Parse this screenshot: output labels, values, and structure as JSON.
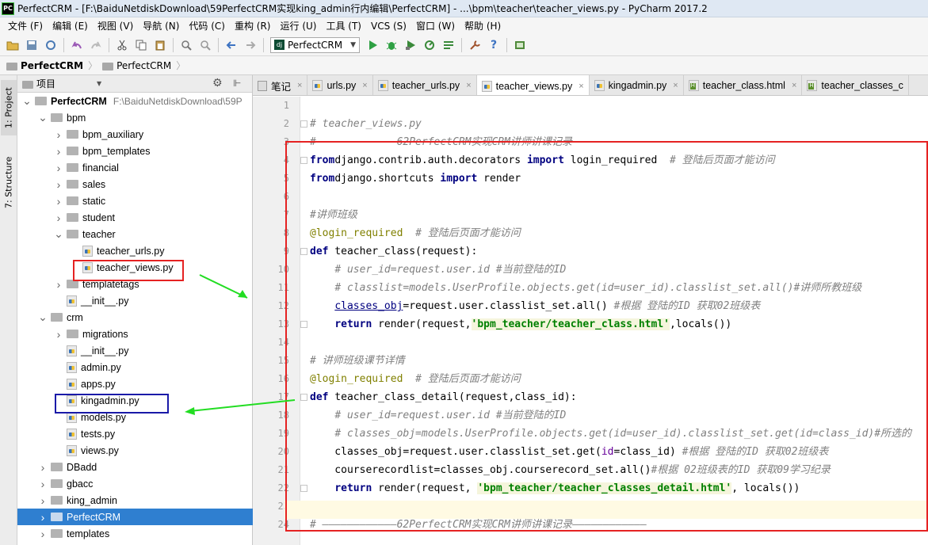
{
  "window": {
    "title": "PerfectCRM - [F:\\BaiduNetdiskDownload\\59PerfectCRM实现king_admin行内编辑\\PerfectCRM] - ...\\bpm\\teacher\\teacher_views.py - PyCharm 2017.2",
    "logo": "PC"
  },
  "menu": [
    "文件 (F)",
    "编辑 (E)",
    "视图 (V)",
    "导航 (N)",
    "代码 (C)",
    "重构 (R)",
    "运行 (U)",
    "工具 (T)",
    "VCS (S)",
    "窗口 (W)",
    "帮助 (H)"
  ],
  "toolbar": {
    "run_config": "PerfectCRM",
    "dj": "dj"
  },
  "breadcrumb": [
    "PerfectCRM",
    "PerfectCRM"
  ],
  "left_tool_tabs": [
    "1: Project",
    "7: Structure"
  ],
  "project_panel": {
    "title": "项目"
  },
  "tree": [
    {
      "label": "PerfectCRM",
      "path": "F:\\BaiduNetdiskDownload\\59P",
      "type": "folder",
      "depth": 0,
      "expanded": true,
      "bold": true
    },
    {
      "label": "bpm",
      "type": "folder",
      "depth": 1,
      "expanded": true
    },
    {
      "label": "bpm_auxiliary",
      "type": "folder",
      "depth": 2,
      "expanded": false
    },
    {
      "label": "bpm_templates",
      "type": "folder",
      "depth": 2,
      "expanded": false
    },
    {
      "label": "financial",
      "type": "folder",
      "depth": 2,
      "expanded": false
    },
    {
      "label": "sales",
      "type": "folder",
      "depth": 2,
      "expanded": false
    },
    {
      "label": "static",
      "type": "folder",
      "depth": 2,
      "expanded": false
    },
    {
      "label": "student",
      "type": "folder",
      "depth": 2,
      "expanded": false
    },
    {
      "label": "teacher",
      "type": "folder",
      "depth": 2,
      "expanded": true
    },
    {
      "label": "teacher_urls.py",
      "type": "py",
      "depth": 3
    },
    {
      "label": "teacher_views.py",
      "type": "py",
      "depth": 3
    },
    {
      "label": "templatetags",
      "type": "folder",
      "depth": 2,
      "expanded": false
    },
    {
      "label": "__init__.py",
      "type": "py",
      "depth": 2
    },
    {
      "label": "crm",
      "type": "folder",
      "depth": 1,
      "expanded": true
    },
    {
      "label": "migrations",
      "type": "folder",
      "depth": 2,
      "expanded": false
    },
    {
      "label": "__init__.py",
      "type": "py",
      "depth": 2
    },
    {
      "label": "admin.py",
      "type": "py",
      "depth": 2
    },
    {
      "label": "apps.py",
      "type": "py",
      "depth": 2
    },
    {
      "label": "kingadmin.py",
      "type": "py",
      "depth": 2
    },
    {
      "label": "models.py",
      "type": "py",
      "depth": 2
    },
    {
      "label": "tests.py",
      "type": "py",
      "depth": 2
    },
    {
      "label": "views.py",
      "type": "py",
      "depth": 2
    },
    {
      "label": "DBadd",
      "type": "folder",
      "depth": 1,
      "expanded": false
    },
    {
      "label": "gbacc",
      "type": "folder",
      "depth": 1,
      "expanded": false
    },
    {
      "label": "king_admin",
      "type": "folder",
      "depth": 1,
      "expanded": false
    },
    {
      "label": "PerfectCRM",
      "type": "folder",
      "depth": 1,
      "expanded": false,
      "selected": true
    },
    {
      "label": "templates",
      "type": "folder",
      "depth": 1,
      "expanded": false
    }
  ],
  "tabs": [
    {
      "label": "笔记",
      "icon": "note",
      "active": false
    },
    {
      "label": "urls.py",
      "icon": "py",
      "active": false
    },
    {
      "label": "teacher_urls.py",
      "icon": "py",
      "active": false
    },
    {
      "label": "teacher_views.py",
      "icon": "py",
      "active": true
    },
    {
      "label": "kingadmin.py",
      "icon": "py",
      "active": false
    },
    {
      "label": "teacher_class.html",
      "icon": "html",
      "active": false
    },
    {
      "label": "teacher_classes_c",
      "icon": "html",
      "active": false
    }
  ],
  "line_numbers": [
    "1",
    "2",
    "3",
    "4",
    "5",
    "6",
    "7",
    "8",
    "9",
    "10",
    "11",
    "12",
    "13",
    "14",
    "15",
    "16",
    "17",
    "18",
    "19",
    "20",
    "21",
    "22",
    "23",
    "24"
  ],
  "code": [
    [],
    [
      [
        "cm",
        "# teacher_views.py"
      ]
    ],
    [
      [
        "cm",
        "# ————————————62PerfectCRM实现CRM讲师讲课记录————————————"
      ]
    ],
    [
      [
        "kw",
        "from"
      ],
      [
        "",
        "django.contrib.auth.decorators "
      ],
      [
        "kw",
        "import"
      ],
      [
        "",
        " login_required  "
      ],
      [
        "cm",
        "# 登陆后页面才能访问"
      ]
    ],
    [
      [
        "kw",
        "from"
      ],
      [
        "",
        "django.shortcuts "
      ],
      [
        "kw",
        "import"
      ],
      [
        "",
        " render"
      ]
    ],
    [],
    [
      [
        "cm",
        "#讲师班级"
      ]
    ],
    [
      [
        "dec",
        "@login_required"
      ],
      [
        "",
        "  "
      ],
      [
        "cm",
        "# 登陆后页面才能访问"
      ]
    ],
    [
      [
        "kw",
        "def"
      ],
      [
        "",
        " teacher_class(request):"
      ]
    ],
    [
      [
        "",
        "    "
      ],
      [
        "cm",
        "# user_id=request.user.id #当前登陆的ID"
      ]
    ],
    [
      [
        "",
        "    "
      ],
      [
        "cm",
        "# classlist=models.UserProfile.objects.get(id=user_id).classlist_set.all()#讲师所教班级"
      ]
    ],
    [
      [
        "",
        "    "
      ],
      [
        "und",
        "classes_obj"
      ],
      [
        "",
        "=request.user.classlist_set.all() "
      ],
      [
        "cm",
        "#根据 登陆的ID 获取02班级表"
      ]
    ],
    [
      [
        "",
        "    "
      ],
      [
        "kw",
        "return"
      ],
      [
        "",
        " render(request,"
      ],
      [
        "str",
        "'bpm_teacher/teacher_class.html'"
      ],
      [
        "",
        ",locals())"
      ]
    ],
    [],
    [
      [
        "cm",
        "# 讲师班级课节详情"
      ]
    ],
    [
      [
        "dec",
        "@login_required"
      ],
      [
        "",
        "  "
      ],
      [
        "cm",
        "# 登陆后页面才能访问"
      ]
    ],
    [
      [
        "kw",
        "def"
      ],
      [
        "",
        " teacher_class_detail(request,class_id):"
      ]
    ],
    [
      [
        "",
        "    "
      ],
      [
        "cm",
        "# user_id=request.user.id #当前登陆的ID"
      ]
    ],
    [
      [
        "",
        "    "
      ],
      [
        "cm",
        "# classes_obj=models.UserProfile.objects.get(id=user_id).classlist_set.get(id=class_id)#所选的"
      ]
    ],
    [
      [
        "",
        "    classes_obj=request.user.classlist_set.get("
      ],
      [
        "eq",
        "id"
      ],
      [
        "",
        "=class_id) "
      ],
      [
        "cm",
        "#根据 登陆的ID 获取02班级表"
      ]
    ],
    [
      [
        "",
        "    courserecordlist=classes_obj.courserecord_set.all()"
      ],
      [
        "cm",
        "#根据 02班级表的ID 获取09学习纪录"
      ]
    ],
    [
      [
        "",
        "    "
      ],
      [
        "kw",
        "return"
      ],
      [
        "",
        " render(request, "
      ],
      [
        "str",
        "'bpm_teacher/teacher_classes_detail.html'"
      ],
      [
        "",
        ", locals())"
      ]
    ],
    [],
    [
      [
        "cm",
        "# ————————————62PerfectCRM实现CRM讲师讲课记录————————————"
      ]
    ]
  ]
}
